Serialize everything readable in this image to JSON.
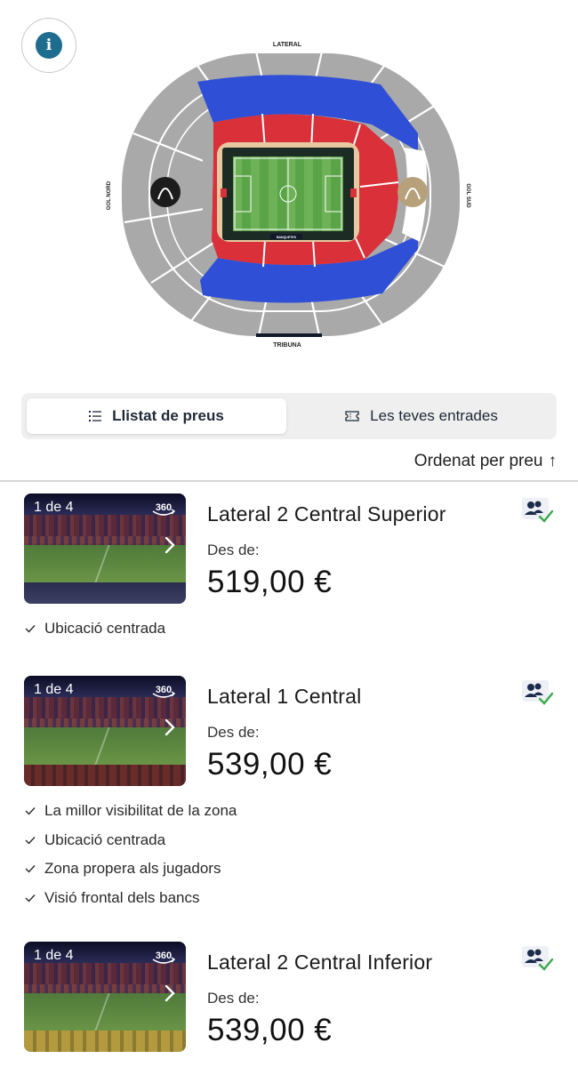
{
  "map": {
    "info_label": "i",
    "labels": {
      "top": "LATERAL",
      "bottom": "TRIBUNA",
      "left": "GOL NORD",
      "right": "GOL SUD",
      "bench": "BANQUETES"
    },
    "colors": {
      "upper_ring": "#a9a9a9",
      "blue_zone": "#2e4fd6",
      "red_zone": "#d9303a",
      "pitch": "#5aa447",
      "pitch_frame": "#1c2b24",
      "white_zone": "#ffffff"
    }
  },
  "tabs": {
    "active": {
      "label": "Llistat de preus",
      "icon": "list-icon"
    },
    "inactive": {
      "label": "Les teves entrades",
      "icon": "ticket-icon"
    }
  },
  "sort": {
    "label": "Ordenat per preu",
    "arrow": "↑"
  },
  "tickets": [
    {
      "photo_counter": "1 de 4",
      "badge_360": "360",
      "title": "Lateral 2 Central Superior",
      "from_label": "Des de:",
      "price": "519,00 €",
      "features": [
        "Ubicació centrada"
      ]
    },
    {
      "photo_counter": "1 de 4",
      "badge_360": "360",
      "title": "Lateral 1 Central",
      "from_label": "Des de:",
      "price": "539,00 €",
      "features": [
        "La millor visibilitat de la zona",
        "Ubicació centrada",
        "Zona propera als jugadors",
        "Visió frontal dels bancs"
      ]
    },
    {
      "photo_counter": "1 de 4",
      "badge_360": "360",
      "title": "Lateral 2 Central Inferior",
      "from_label": "Des de:",
      "price": "539,00 €",
      "features": []
    }
  ]
}
